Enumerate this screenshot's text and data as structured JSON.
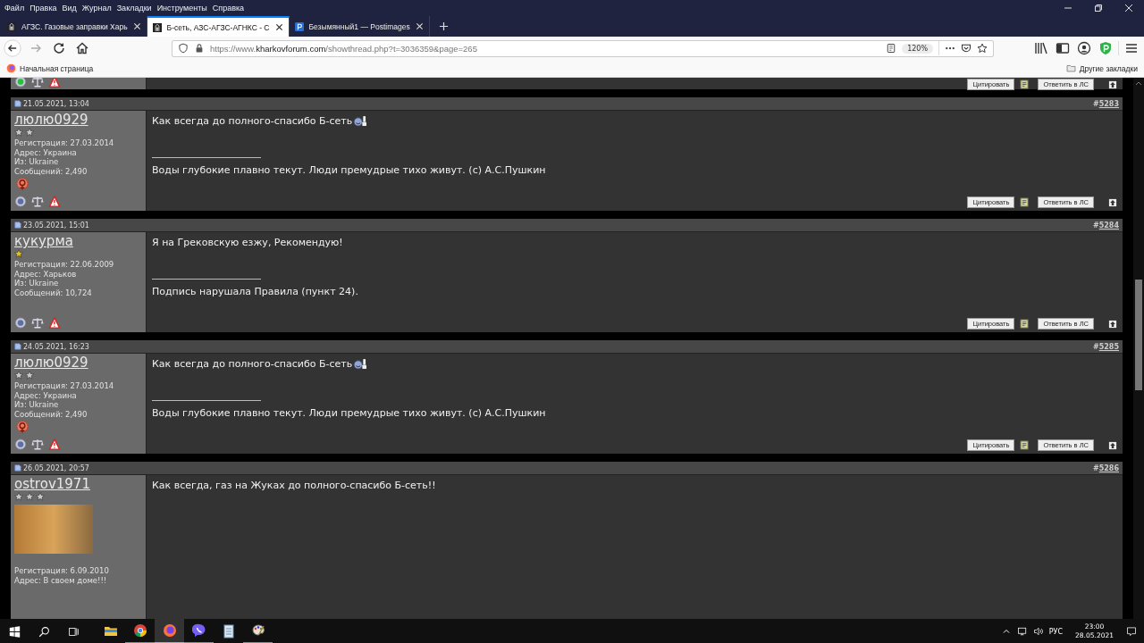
{
  "menu": [
    "Файл",
    "Правка",
    "Вид",
    "Журнал",
    "Закладки",
    "Инструменты",
    "Справка"
  ],
  "tabs": [
    {
      "title": "АГЗС. Газовые заправки Харь",
      "selected": false,
      "kind": "site"
    },
    {
      "title": "Б-сеть, АЗС-АГЗС-АГНКС - С",
      "selected": true,
      "kind": "site"
    },
    {
      "title": "Безымянный1 — Postimages",
      "selected": false,
      "kind": "postimages"
    }
  ],
  "address": {
    "scheme": "https://www.",
    "domain": "kharkovforum.com",
    "path": "/showthread.php?t=3036359&page=265",
    "zoom": "120%"
  },
  "bookmarks": {
    "home": "Начальная страница",
    "other": "Другие закладки"
  },
  "top_footer": {
    "online": true,
    "quote": "Цитировать",
    "pm": "Ответить в ЛС"
  },
  "posts": [
    {
      "date": "21.05.2021, 13:04",
      "number_prefix": "#",
      "number": "5283",
      "user": "люлю0929",
      "rank_stars": [
        {
          "color": "#c8c8c8"
        },
        {
          "color": "#c8c8c8"
        }
      ],
      "avatar": false,
      "info": [
        "Регистрация: 27.03.2014",
        "Адрес: Украина",
        "Из: Ukraine",
        "Сообщений: 2,490"
      ],
      "reputation": true,
      "message": "Как всегда до полного-спасибо Б-сеть",
      "smiley": true,
      "signature": "Воды глубокие плавно текут. Люди премудрые тихо живут. (c) А.С.Пушкин",
      "footer": {
        "online": false,
        "quote": "Цитировать",
        "pm": "Ответить в ЛС"
      }
    },
    {
      "date": "23.05.2021, 15:01",
      "number_prefix": "#",
      "number": "5284",
      "user": "кукурма",
      "rank_stars": [
        {
          "color": "#e0c020"
        }
      ],
      "avatar": false,
      "info": [
        "Регистрация: 22.06.2009",
        "Адрес: Харьков",
        "Из: Ukraine",
        "Сообщений: 10,724"
      ],
      "reputation": false,
      "message": "Я на Грековскую езжу, Рекомендую!",
      "smiley": false,
      "signature": "Подпись нарушала Правила (пункт 24).",
      "footer": {
        "online": false,
        "quote": "Цитировать",
        "pm": "Ответить в ЛС"
      }
    },
    {
      "date": "24.05.2021, 16:23",
      "number_prefix": "#",
      "number": "5285",
      "user": "люлю0929",
      "rank_stars": [
        {
          "color": "#c8c8c8"
        },
        {
          "color": "#c8c8c8"
        }
      ],
      "avatar": false,
      "info": [
        "Регистрация: 27.03.2014",
        "Адрес: Украина",
        "Из: Ukraine",
        "Сообщений: 2,490"
      ],
      "reputation": true,
      "message": "Как всегда до полного-спасибо Б-сеть ",
      "smiley": true,
      "signature": "Воды глубокие плавно текут. Люди премудрые тихо живут. (c) А.С.Пушкин",
      "footer": {
        "online": false,
        "quote": "Цитировать",
        "pm": "Ответить в ЛС"
      }
    },
    {
      "date": "26.05.2021, 20:57",
      "number_prefix": "#",
      "number": "5286",
      "user": "ostrov1971",
      "rank_stars": [
        {
          "color": "#c8c8c8"
        },
        {
          "color": "#c8c8c8"
        },
        {
          "color": "#c8c8c8"
        }
      ],
      "avatar": true,
      "info": [
        "Регистрация: 6.09.2010",
        "Адрес: В своем доме!!!"
      ],
      "reputation": false,
      "message": "Как всегда, газ на Жуках до полного-спасибо Б-сеть!!",
      "smiley": false
    }
  ],
  "taskbar": {
    "apps": [
      {
        "kind": "explorer",
        "running": false,
        "selected": false
      },
      {
        "kind": "chrome",
        "running": true,
        "selected": false
      },
      {
        "kind": "firefox",
        "running": true,
        "selected": true
      },
      {
        "kind": "viber",
        "running": true,
        "selected": false
      },
      {
        "kind": "notepad",
        "running": false,
        "selected": false
      },
      {
        "kind": "paint",
        "running": true,
        "selected": false
      }
    ],
    "language": "РУС",
    "time": "23:00",
    "date": "28.05.2021"
  }
}
